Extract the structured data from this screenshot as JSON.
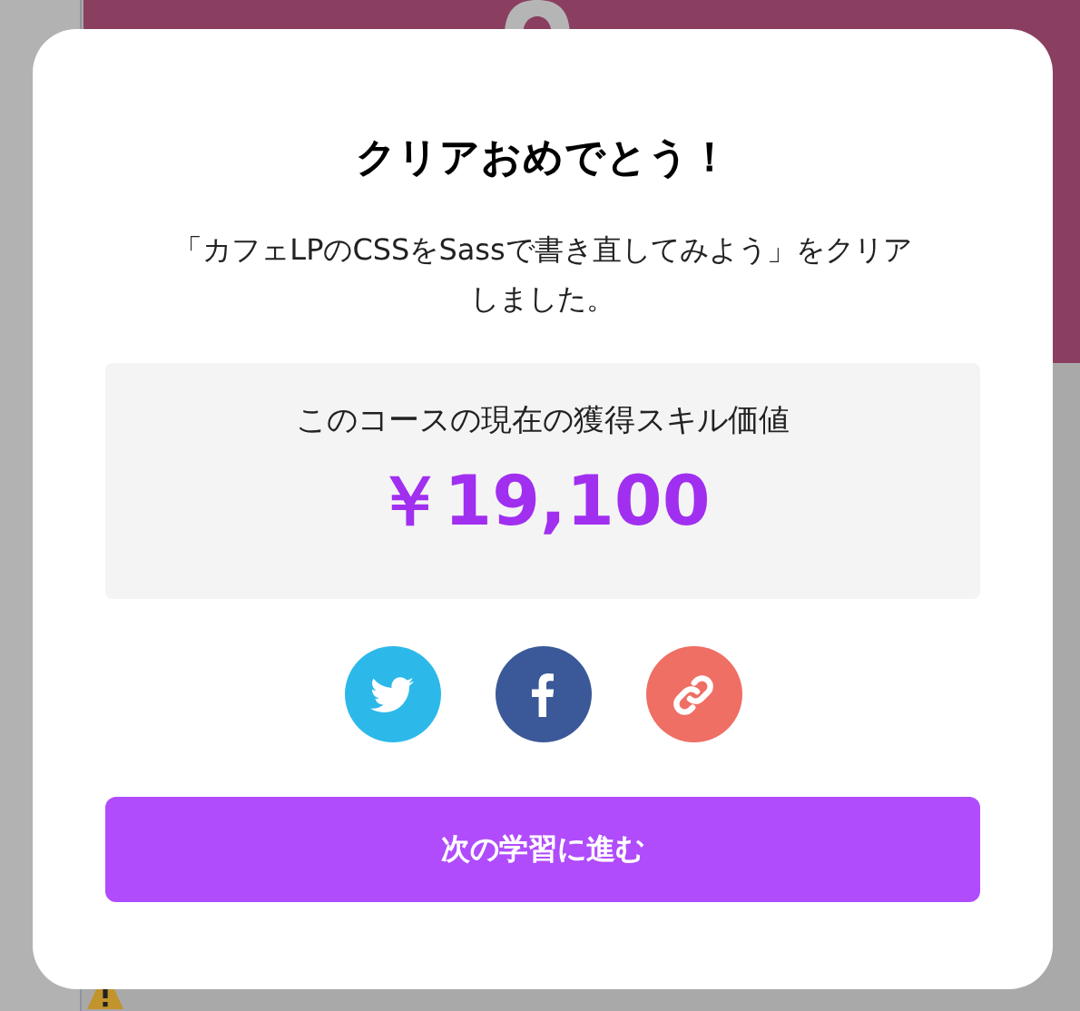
{
  "modal": {
    "title": "クリアおめでとう！",
    "message": "「カフェLPのCSSをSassで書き直してみよう」をクリアしました。",
    "skill": {
      "label": "このコースの現在の獲得スキル価値",
      "value": "￥19,100"
    },
    "share": [
      {
        "kind": "twitter",
        "color": "#2cb9ea"
      },
      {
        "kind": "facebook",
        "color": "#3b5998"
      },
      {
        "kind": "link",
        "color": "#ef6f65"
      }
    ],
    "next_button": "次の学習に進む"
  }
}
